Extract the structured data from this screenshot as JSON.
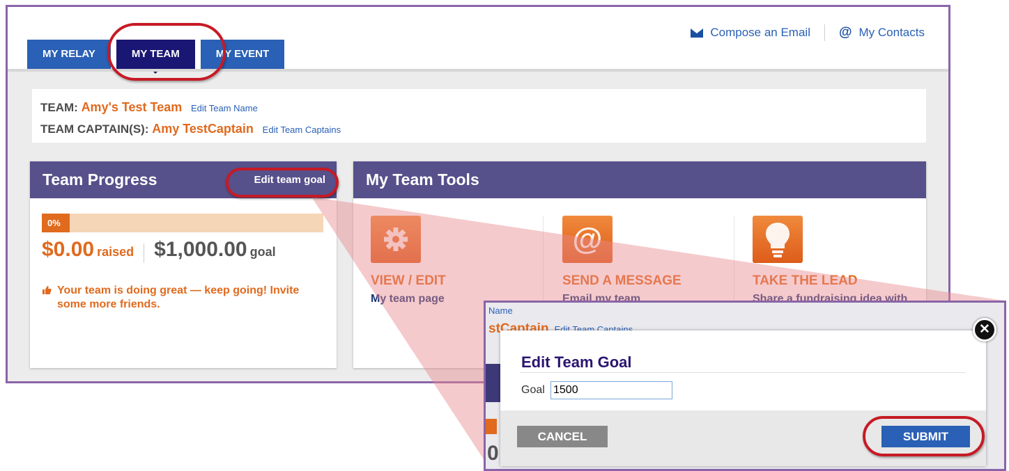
{
  "tabs": [
    {
      "label": "MY RELAY"
    },
    {
      "label": "MY TEAM"
    },
    {
      "label": "MY EVENT"
    }
  ],
  "top_links": {
    "compose": "Compose an Email",
    "contacts": "My Contacts"
  },
  "team_info": {
    "team_label": "TEAM:",
    "team_name": "Amy's Test Team",
    "edit_team_name": "Edit Team Name",
    "captain_label": "TEAM CAPTAIN(S):",
    "captain_name": "Amy TestCaptain",
    "edit_captains": "Edit Team Captains"
  },
  "progress": {
    "title": "Team Progress",
    "edit_goal": "Edit team goal",
    "percent_label": "0%",
    "percent": 0,
    "raised": "$0.00",
    "raised_unit": "raised",
    "goal": "$1,000.00",
    "goal_unit": "goal",
    "message": "Your team is doing great — keep going! Invite some more friends."
  },
  "tools": {
    "title": "My Team Tools",
    "items": [
      {
        "title": "VIEW / EDIT",
        "sub": "My team page",
        "icon": "gear-icon"
      },
      {
        "title": "SEND A MESSAGE",
        "sub": "Email my team",
        "icon": "at-sign-icon"
      },
      {
        "title": "TAKE THE LEAD",
        "sub": "Share a fundraising idea with",
        "icon": "lightbulb-icon"
      }
    ]
  },
  "zoom": {
    "ghost_name": "Name",
    "ghost_captain": "stCaptain",
    "ghost_edit": "Edit Team Captains",
    "ghost_zero": "0",
    "dialog_title": "Edit Team Goal",
    "goal_label": "Goal",
    "goal_value": "1500",
    "cancel": "CANCEL",
    "submit": "SUBMIT",
    "close_glyph": "✕"
  },
  "colors": {
    "tab_blue": "#2a60b5",
    "tab_active": "#1a1673",
    "header_purple": "#56508b",
    "accent_orange": "#e06a1e",
    "highlight_red": "#c61a25",
    "frame_purple": "#8a64a8"
  }
}
